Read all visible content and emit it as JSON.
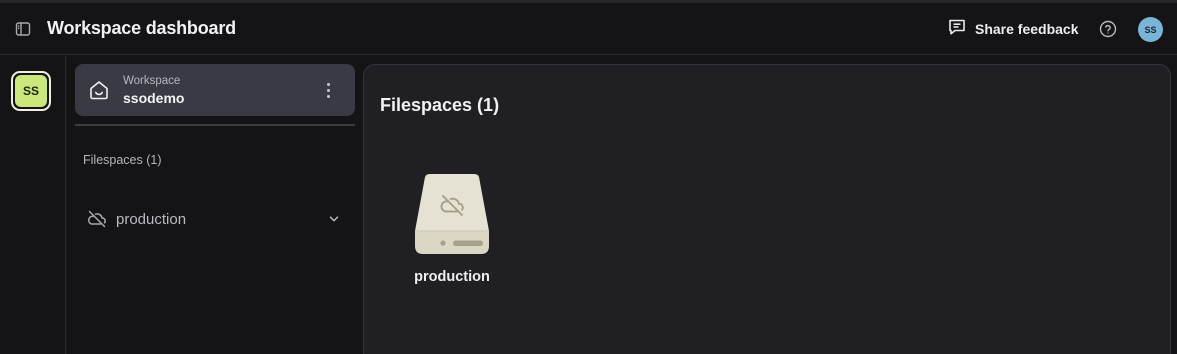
{
  "header": {
    "title": "Workspace dashboard",
    "feedback_label": "Share feedback",
    "user_initials": "SS",
    "icons": {
      "toggle": "sidebar-toggle-icon",
      "feedback": "message-square-icon",
      "help": "help-circle-icon"
    }
  },
  "rail": {
    "workspace_initials": "SS",
    "avatar_color": "#c9e77b"
  },
  "sidebar": {
    "workspace_label": "Workspace",
    "workspace_name": "ssodemo",
    "section_title": "Filespaces (1)",
    "filespaces": [
      {
        "name": "production",
        "icon": "cloud-off-icon",
        "expanded": false
      }
    ]
  },
  "main": {
    "title": "Filespaces (1)",
    "drives": [
      {
        "name": "production",
        "icon": "cloud-off-icon"
      }
    ]
  },
  "colors": {
    "background": "#141417",
    "panel": "#1f1f24",
    "card": "#3a3a44",
    "accent_green": "#c9e77b",
    "user_avatar": "#7ab4d6",
    "drive_body": "#e6e2d3"
  }
}
